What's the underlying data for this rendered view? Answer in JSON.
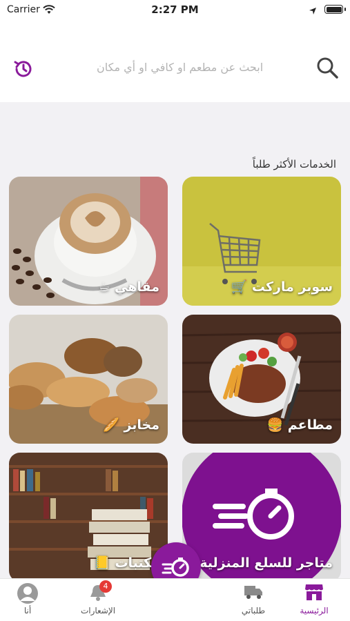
{
  "status_bar": {
    "carrier": "Carrier",
    "time": "2:27 PM"
  },
  "search": {
    "placeholder": "ابحث عن مطعم او كافي او أي مكان"
  },
  "section_title": "الخدمات الأكثر طلباً",
  "cards": [
    {
      "label": "سوبر ماركت 🛒"
    },
    {
      "label": "مقاهي ☕"
    },
    {
      "label": "مطاعم 🍔"
    },
    {
      "label": "مخابز 🥖"
    },
    {
      "label": "متاجر للسلع المنزلية 🏠"
    },
    {
      "label": "مكتبات 📒"
    }
  ],
  "tabbar": {
    "home": "الرئيسية",
    "orders": "طلباتي",
    "notifications": "الإشعارات",
    "notifications_count": "4",
    "me": "أنا"
  },
  "colors": {
    "accent": "#8a1a9b"
  }
}
